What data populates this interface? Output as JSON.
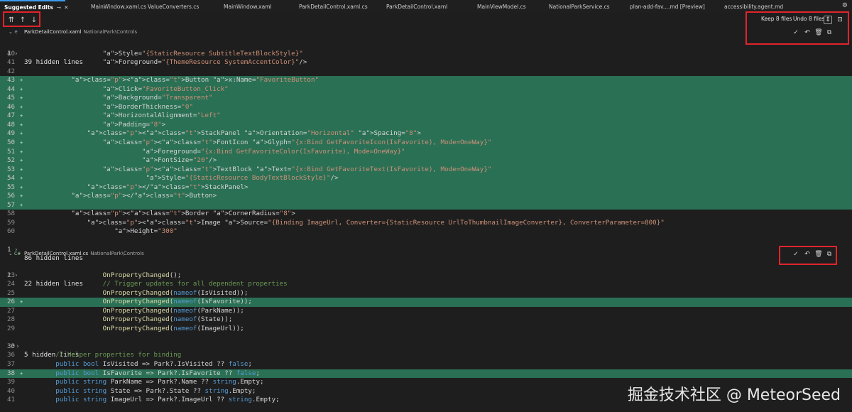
{
  "tabs": [
    {
      "label": "Suggested Edits",
      "active": true
    },
    {
      "label": "MainWindow.xaml.cs"
    },
    {
      "label": "ValueConverters.cs"
    },
    {
      "label": "MainWindow.xaml"
    },
    {
      "label": "ParkDetailControl.xaml.cs"
    },
    {
      "label": "ParkDetailControl.xaml"
    },
    {
      "label": "MainViewModel.cs"
    },
    {
      "label": "NationalParkService.cs"
    },
    {
      "label": "plan-add-fav....md [Preview]"
    },
    {
      "label": "accessibility.agent.md"
    }
  ],
  "toolbar": {
    "keep_label": "Keep 8 files",
    "undo_label": "Undo 8 files"
  },
  "files": [
    {
      "name": "ParkDetailControl.xaml",
      "type": "xaml",
      "path": "NationalPark\\Controls"
    },
    {
      "name": "ParkDetailControl.xaml.cs",
      "type": "C#",
      "path": "NationalPark\\Controls"
    }
  ],
  "hidden": {
    "h1_num": "1",
    "h1_text": "39 hidden lines",
    "h2_num": "1",
    "h2_text": "86 hidden lines",
    "h3_num": "1",
    "h3_text": "22 hidden lines",
    "h4_num": "30",
    "h4_text": "5 hidden lines"
  },
  "xaml_lines": [
    {
      "n": "40",
      "add": false,
      "code": "                    Style=\"{StaticResource SubtitleTextBlockStyle}\""
    },
    {
      "n": "41",
      "add": false,
      "code": "                    Foreground=\"{ThemeResource SystemAccentColor}\"/>"
    },
    {
      "n": "42",
      "add": false,
      "code": ""
    },
    {
      "n": "43",
      "add": true,
      "code": "            <Button x:Name=\"FavoriteButton\""
    },
    {
      "n": "44",
      "add": true,
      "code": "                    Click=\"FavoriteButton_Click\""
    },
    {
      "n": "45",
      "add": true,
      "code": "                    Background=\"Transparent\""
    },
    {
      "n": "46",
      "add": true,
      "code": "                    BorderThickness=\"0\""
    },
    {
      "n": "47",
      "add": true,
      "code": "                    HorizontalAlignment=\"Left\""
    },
    {
      "n": "48",
      "add": true,
      "code": "                    Padding=\"8\">"
    },
    {
      "n": "49",
      "add": true,
      "code": "                <StackPanel Orientation=\"Horizontal\" Spacing=\"8\">"
    },
    {
      "n": "50",
      "add": true,
      "code": "                    <FontIcon Glyph=\"{x:Bind GetFavoriteIcon(IsFavorite), Mode=OneWay}\""
    },
    {
      "n": "51",
      "add": true,
      "code": "                              Foreground=\"{x:Bind GetFavoriteColor(IsFavorite), Mode=OneWay}\""
    },
    {
      "n": "52",
      "add": true,
      "code": "                              FontSize=\"20\"/>"
    },
    {
      "n": "53",
      "add": true,
      "code": "                    <TextBlock Text=\"{x:Bind GetFavoriteText(IsFavorite), Mode=OneWay}\""
    },
    {
      "n": "54",
      "add": true,
      "code": "                               Style=\"{StaticResource BodyTextBlockStyle}\"/>"
    },
    {
      "n": "55",
      "add": true,
      "code": "                </StackPanel>"
    },
    {
      "n": "56",
      "add": true,
      "code": "            </Button>"
    },
    {
      "n": "57",
      "add": true,
      "code": ""
    },
    {
      "n": "58",
      "add": false,
      "code": "            <Border CornerRadius=\"8\">"
    },
    {
      "n": "59",
      "add": false,
      "code": "                <Image Source=\"{Binding ImageUrl, Converter={StaticResource UrlToThumbnailImageConverter}, ConverterParameter=800}\""
    },
    {
      "n": "60",
      "add": false,
      "code": "                       Height=\"300\""
    }
  ],
  "cs_lines_a": [
    {
      "n": "23",
      "add": false,
      "code": "                    OnPropertyChanged();"
    },
    {
      "n": "24",
      "add": false,
      "code": "                    // Trigger updates for all dependent properties"
    },
    {
      "n": "25",
      "add": false,
      "code": "                    OnPropertyChanged(nameof(IsVisited));"
    },
    {
      "n": "26",
      "add": true,
      "code": "                    OnPropertyChanged(nameof(IsFavorite));"
    },
    {
      "n": "27",
      "add": false,
      "code": "                    OnPropertyChanged(nameof(ParkName));"
    },
    {
      "n": "28",
      "add": false,
      "code": "                    OnPropertyChanged(nameof(State));"
    },
    {
      "n": "29",
      "add": false,
      "code": "                    OnPropertyChanged(nameof(ImageUrl));"
    }
  ],
  "cs_lines_b": [
    {
      "n": "35",
      "add": false,
      "code": ""
    },
    {
      "n": "36",
      "add": false,
      "code": "        // Helper properties for binding"
    },
    {
      "n": "37",
      "add": false,
      "code": "        public bool IsVisited => Park?.IsVisited ?? false;"
    },
    {
      "n": "38",
      "add": true,
      "code": "        public bool IsFavorite => Park?.IsFavorite ?? false;"
    },
    {
      "n": "39",
      "add": false,
      "code": "        public string ParkName => Park?.Name ?? string.Empty;"
    },
    {
      "n": "40",
      "add": false,
      "code": "        public string State => Park?.State ?? string.Empty;"
    },
    {
      "n": "41",
      "add": false,
      "code": "        public string ImageUrl => Park?.ImageUrl ?? string.Empty;"
    }
  ],
  "watermark": "掘金技术社区 @ MeteorSeed",
  "icons": {
    "prev_all": "chevron-double-up-icon",
    "prev": "arrow-up-icon",
    "next": "arrow-down-icon",
    "accept": "check-icon",
    "undo": "undo-icon",
    "discard": "trash-icon",
    "open": "open-file-icon"
  }
}
